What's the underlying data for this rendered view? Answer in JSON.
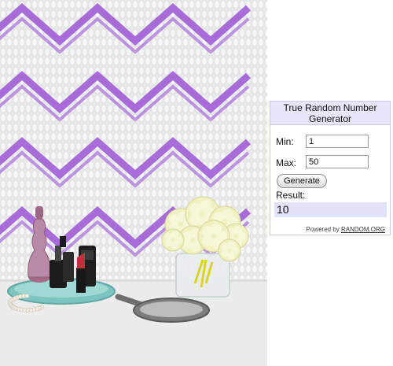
{
  "widget": {
    "title": "True Random Number Generator",
    "min_label": "Min:",
    "min_value": "1",
    "max_label": "Max:",
    "max_value": "50",
    "generate_label": "Generate",
    "result_label": "Result:",
    "result_value": "10",
    "powered_prefix": "Powered by",
    "powered_link": "RANDOM.ORG"
  },
  "colors": {
    "zigzag_purple": "#a76cd8",
    "title_bar": "#e7e7fb",
    "result_bg": "#e2e2fb"
  },
  "icons": [
    "zigzag-wallpaper",
    "perfume-bottle",
    "lipstick",
    "flower-vase",
    "hand-mirror",
    "pearl-necklace"
  ]
}
